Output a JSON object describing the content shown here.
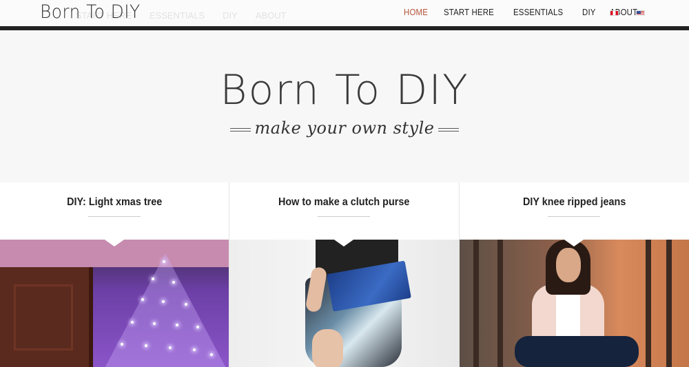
{
  "header": {
    "logo_text": "Born To DIY",
    "ghost_nav": [
      "START HERE",
      "ESSENTIALS",
      "DIY",
      "ABOUT"
    ],
    "nav": [
      {
        "label": "HOME",
        "active": true
      },
      {
        "label": "START HERE",
        "active": false
      },
      {
        "label": "ESSENTIALS",
        "active": false
      },
      {
        "label": "DIY",
        "active": false
      },
      {
        "label": "ABOUT",
        "active": false
      }
    ],
    "languages": [
      {
        "icon": "peru-flag-icon"
      },
      {
        "icon": "us-flag-icon"
      }
    ],
    "active_color": "#b5533a"
  },
  "hero": {
    "title": "Born To DIY",
    "tagline": "make your own style"
  },
  "posts": [
    {
      "title": "DIY: Light xmas tree"
    },
    {
      "title": "How to make a clutch purse"
    },
    {
      "title": "DIY knee ripped jeans"
    }
  ]
}
